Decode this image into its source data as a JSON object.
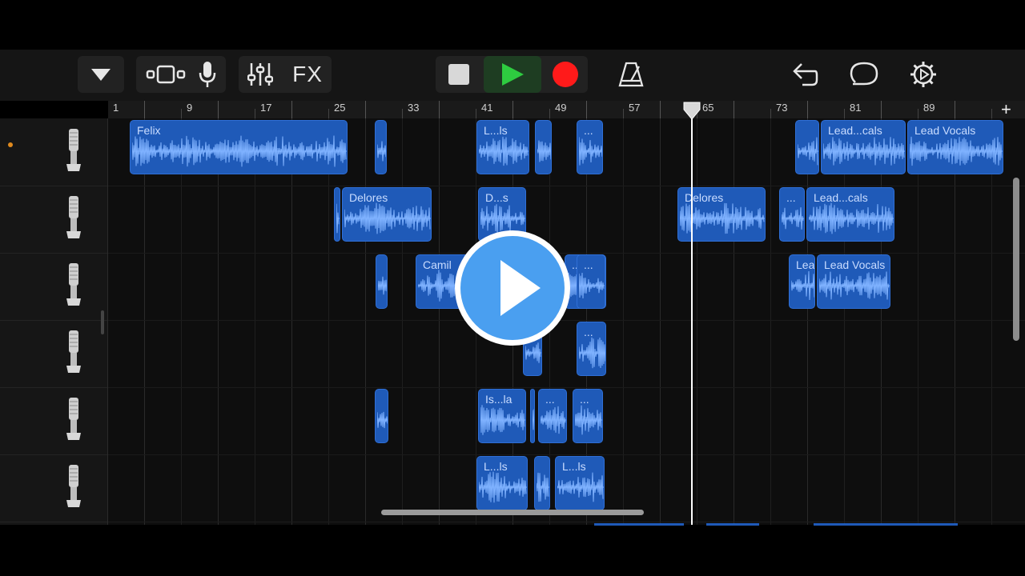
{
  "toolbar": {
    "fx_label": "FX",
    "colors": {
      "play": "#2ecc40",
      "record": "#ff1a1a",
      "region": "#1f5ab8"
    }
  },
  "ruler": {
    "labels": [
      "1",
      "9",
      "17",
      "25",
      "33",
      "41",
      "49",
      "57",
      "65",
      "73",
      "81",
      "89"
    ],
    "add_label": "+"
  },
  "tracks": [
    {
      "icon": "microphone-icon",
      "regions": [
        "Felix",
        "",
        "L...ls",
        "",
        "...",
        "",
        "Lead...cals",
        "Lead Vocals"
      ]
    },
    {
      "icon": "microphone-icon",
      "regions": [
        "",
        "Delores",
        "D...s",
        "Delores",
        "...",
        "Lead...cals"
      ]
    },
    {
      "icon": "microphone-icon",
      "regions": [
        "",
        "Camil",
        "...",
        "...",
        "Lea...als",
        "Lead Vocals"
      ]
    },
    {
      "icon": "microphone-icon",
      "regions": [
        "",
        "..."
      ]
    },
    {
      "icon": "microphone-icon",
      "regions": [
        "",
        "Is...la",
        "",
        "...",
        "..."
      ]
    },
    {
      "icon": "microphone-icon",
      "regions": [
        "L...ls",
        "",
        "L...ls"
      ]
    }
  ],
  "overlay": {
    "icon": "play-video-icon"
  }
}
